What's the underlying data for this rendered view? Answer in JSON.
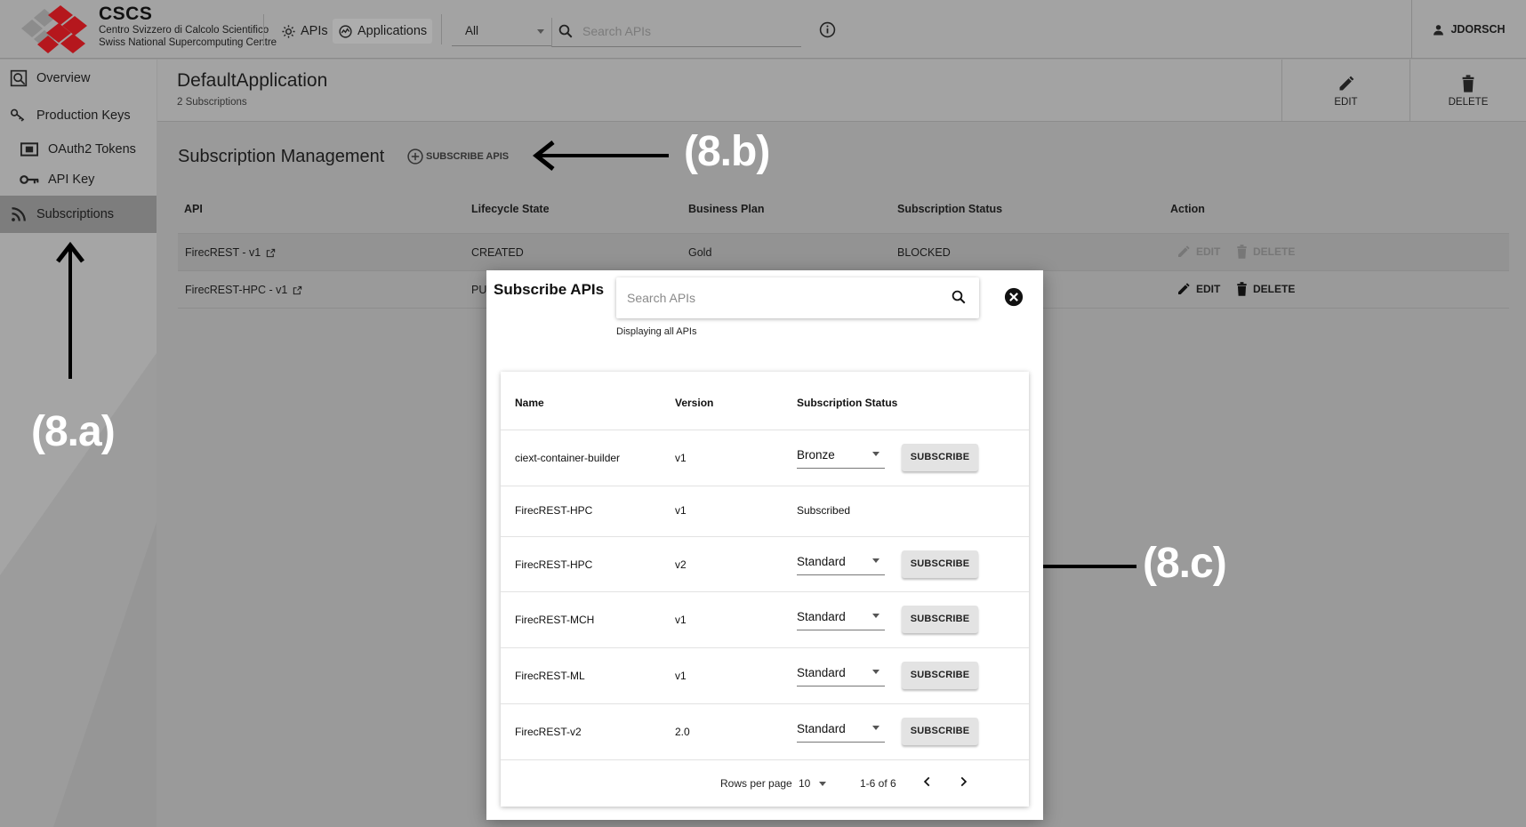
{
  "topbar": {
    "brand": "CSCS",
    "brand_line1": "Centro Svizzero di Calcolo Scientifico",
    "brand_line2": "Swiss National Supercomputing Centre",
    "nav_apis": "APIs",
    "nav_applications": "Applications",
    "filter_value": "All",
    "search_placeholder": "Search APIs",
    "user": "JDORSCH"
  },
  "sidebar": {
    "items": [
      {
        "label": "Overview"
      },
      {
        "label": "Production Keys"
      },
      {
        "label": "OAuth2 Tokens"
      },
      {
        "label": "API Key"
      },
      {
        "label": "Subscriptions"
      }
    ]
  },
  "header": {
    "title": "DefaultApplication",
    "subtitle": "2 Subscriptions",
    "edit_label": "EDIT",
    "delete_label": "DELETE"
  },
  "subscriptions": {
    "title": "Subscription Management",
    "subscribe_apis_label": "SUBSCRIBE APIS",
    "columns": [
      "API",
      "Lifecycle State",
      "Business Plan",
      "Subscription Status",
      "Action"
    ],
    "rows": [
      {
        "api": "FirecREST - v1",
        "state": "CREATED",
        "plan": "Gold",
        "status": "BLOCKED",
        "edit": "EDIT",
        "delete": "DELETE"
      },
      {
        "api": "FirecREST-HPC - v1",
        "state": "PU",
        "plan": "",
        "status": "",
        "edit": "EDIT",
        "delete": "DELETE"
      }
    ]
  },
  "annotations": {
    "a": "(8.a)",
    "b": "(8.b)",
    "c": "(8.c)"
  },
  "modal": {
    "title": "Subscribe APIs",
    "search_placeholder": "Search APIs",
    "displaying": "Displaying all APIs",
    "columns": [
      "Name",
      "Version",
      "Subscription Status"
    ],
    "rows": [
      {
        "name": "ciext-container-builder",
        "version": "v1",
        "plan": "Bronze",
        "action": "SUBSCRIBE"
      },
      {
        "name": "FirecREST-HPC",
        "version": "v1",
        "status": "Subscribed"
      },
      {
        "name": "FirecREST-HPC",
        "version": "v2",
        "plan": "Standard",
        "action": "SUBSCRIBE"
      },
      {
        "name": "FirecREST-MCH",
        "version": "v1",
        "plan": "Standard",
        "action": "SUBSCRIBE"
      },
      {
        "name": "FirecREST-ML",
        "version": "v1",
        "plan": "Standard",
        "action": "SUBSCRIBE"
      },
      {
        "name": "FirecREST-v2",
        "version": "2.0",
        "plan": "Standard",
        "action": "SUBSCRIBE"
      }
    ],
    "pagination": {
      "rows_per_page_label": "Rows per page",
      "rows_per_page": "10",
      "range": "1-6 of 6"
    }
  },
  "colors": {
    "overlay_gray": "#9a9a9a",
    "sidebar_active": "#7d7d7d",
    "logo_red": "#c0161c",
    "annotation": "#ffffff"
  }
}
